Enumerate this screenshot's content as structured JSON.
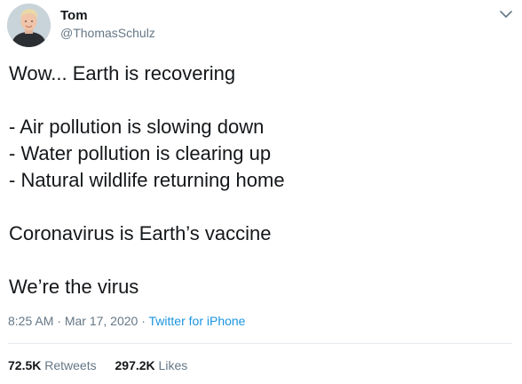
{
  "author": {
    "name": "Tom",
    "handle": "@ThomasSchulz"
  },
  "tweet": {
    "lines": [
      "Wow... Earth is recovering",
      "",
      "- Air pollution is slowing down",
      "- Water pollution is clearing up",
      "- Natural wildlife returning home",
      "",
      "Coronavirus is Earth’s vaccine",
      "",
      "We’re the virus"
    ],
    "time": "8:25 AM",
    "separator_1": "·",
    "date": "Mar 17, 2020",
    "separator_2": "·",
    "source": "Twitter for iPhone"
  },
  "stats": {
    "retweets_count": "72.5K",
    "retweets_label": "Retweets",
    "likes_count": "297.2K",
    "likes_label": "Likes"
  },
  "icons": {
    "caret": "chevron-down-icon"
  },
  "colors": {
    "text": "#14171a",
    "secondary": "#657786",
    "link": "#1b95e0",
    "divider": "#e6ecf0"
  }
}
